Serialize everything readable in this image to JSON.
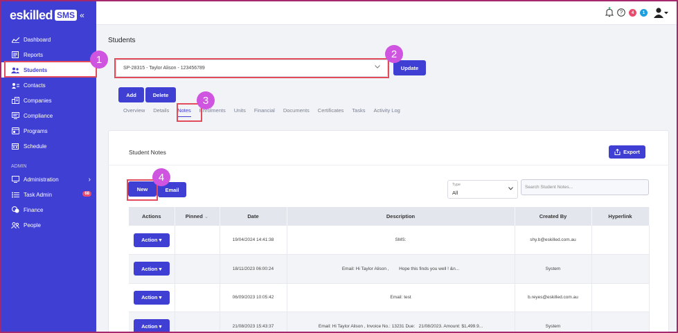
{
  "app": {
    "logo_text": "eskilled",
    "logo_badge": "SMS",
    "collapse_glyph": "«"
  },
  "sidebar": {
    "items": [
      {
        "label": "Dashboard",
        "icon": "chart-line-icon"
      },
      {
        "label": "Reports",
        "icon": "report-icon"
      },
      {
        "label": "Students",
        "icon": "users-icon",
        "active": true
      },
      {
        "label": "Contacts",
        "icon": "contact-card-icon"
      },
      {
        "label": "Companies",
        "icon": "building-icon"
      },
      {
        "label": "Compliance",
        "icon": "compliance-icon"
      },
      {
        "label": "Programs",
        "icon": "programs-icon"
      },
      {
        "label": "Schedule",
        "icon": "calendar-icon"
      }
    ],
    "section_label": "ADMIN",
    "admin_items": [
      {
        "label": "Administration",
        "icon": "monitor-icon",
        "chevron": "›"
      },
      {
        "label": "Task Admin",
        "icon": "list-icon",
        "badge": "68"
      },
      {
        "label": "Finance",
        "icon": "coins-icon"
      },
      {
        "label": "People",
        "icon": "people-icon"
      }
    ]
  },
  "topbar": {
    "help_badge": "4",
    "info_badge": "1"
  },
  "page": {
    "title": "Students",
    "student_selector": "SP-28315 - Taylor Alison - 123456789",
    "update_label": "Update",
    "add_label": "Add",
    "delete_label": "Delete",
    "tabs": [
      "Overview",
      "Details",
      "Notes",
      "Enrolments",
      "Units",
      "Financial",
      "Documents",
      "Certificates",
      "Tasks",
      "Activity Log"
    ]
  },
  "notes": {
    "title": "Student Notes",
    "export_label": "Export",
    "new_label": "New",
    "email_label": "Email",
    "type_label": "Type",
    "type_value": "All",
    "search_placeholder": "Search Student Notes...",
    "columns": [
      "Actions",
      "Pinned",
      "Date",
      "Description",
      "Created By",
      "Hyperlink"
    ],
    "action_label": "Action",
    "rows": [
      {
        "date": "19/04/2024 14:41:38",
        "description": "SMS:",
        "created_by": "shy.b@eskilled.com.au"
      },
      {
        "date": "18/11/2023 06:00:24",
        "description": "Email: Hi Taylor Alison ,        Hope this finds you well ! &n...",
        "created_by": "System"
      },
      {
        "date": "06/09/2023 10:05:42",
        "description": "Email: test",
        "created_by": "b.reyes@eskilled.com.au"
      },
      {
        "date": "21/08/2023 15:43:37",
        "description": "Email: Hi Taylor Alison , Invoice No.: 13231 Due:   21/08/2023. Amount: $1,499.9...",
        "created_by": "System"
      }
    ]
  },
  "callouts": [
    "1",
    "2",
    "3",
    "4"
  ],
  "colors": {
    "brand": "#3f3fd4",
    "highlight": "#e24b5a",
    "callout": "#cf55e0"
  }
}
